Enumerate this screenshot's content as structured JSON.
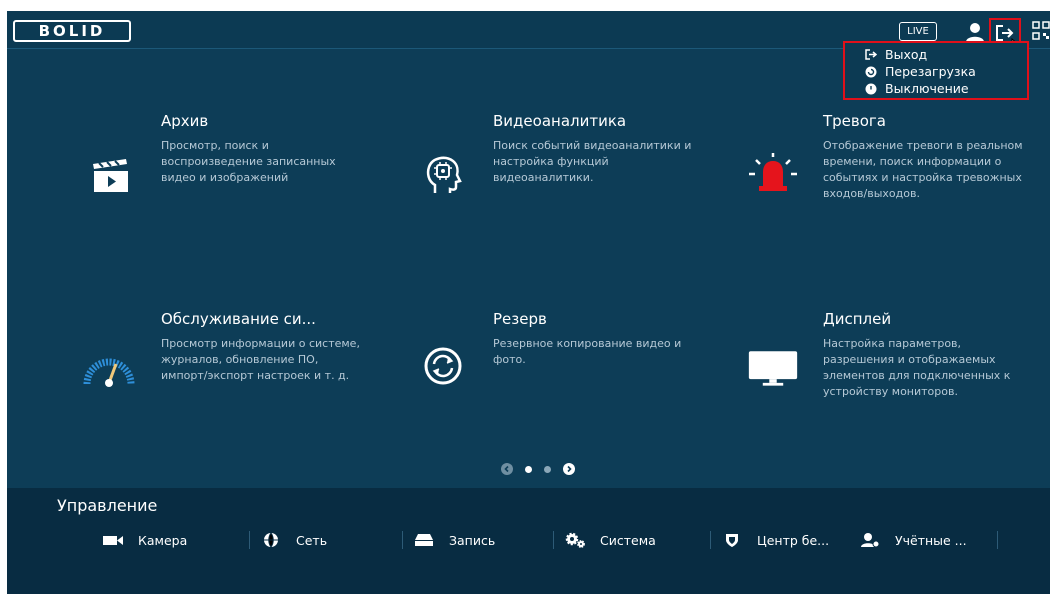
{
  "topbar": {
    "logo_text": "BOLID",
    "live_label": "LIVE"
  },
  "dropdown": {
    "items": [
      {
        "label": "Выход",
        "icon": "logout-icon"
      },
      {
        "label": "Перезагрузка",
        "icon": "reboot-icon"
      },
      {
        "label": "Выключение",
        "icon": "power-icon"
      }
    ]
  },
  "tiles": [
    {
      "title": "Архив",
      "description": "Просмотр, поиск и воспроизведение записанных видео и изображений",
      "icon": "clapperboard-icon"
    },
    {
      "title": "Видеоаналитика",
      "description": "Поиск событий видеоаналитики и настройка функций видеоаналитики.",
      "icon": "ai-head-icon"
    },
    {
      "title": "Тревога",
      "description": "Отображение тревоги в реальном времени, поиск информации о событиях и настройка тревожных входов/выходов.",
      "icon": "alarm-siren-icon"
    },
    {
      "title": "Обслуживание си...",
      "description": "Просмотр информации о системе, журналов, обновление ПО, импорт/экспорт настроек и т. д.",
      "icon": "gauge-icon"
    },
    {
      "title": "Резерв",
      "description": "Резервное копирование видео и фото.",
      "icon": "backup-sync-icon"
    },
    {
      "title": "Дисплей",
      "description": "Настройка параметров, разрешения и отображаемых элементов для подключенных к устройству мониторов.",
      "icon": "monitor-icon"
    }
  ],
  "pager": {
    "pages": 2,
    "current": 1
  },
  "management": {
    "title": "Управление",
    "items": [
      {
        "label": "Камера",
        "icon": "camera-icon"
      },
      {
        "label": "Сеть",
        "icon": "network-globe-icon"
      },
      {
        "label": "Запись",
        "icon": "hdd-icon"
      },
      {
        "label": "Система",
        "icon": "gears-icon"
      },
      {
        "label": "Центр бе...",
        "icon": "shield-icon"
      },
      {
        "label": "Учётные ...",
        "icon": "accounts-icon"
      }
    ]
  },
  "colors": {
    "background": "#0d3d57",
    "bottom_panel": "#082c42",
    "highlight_red": "#e0101a",
    "alarm_red": "#e5141c"
  }
}
